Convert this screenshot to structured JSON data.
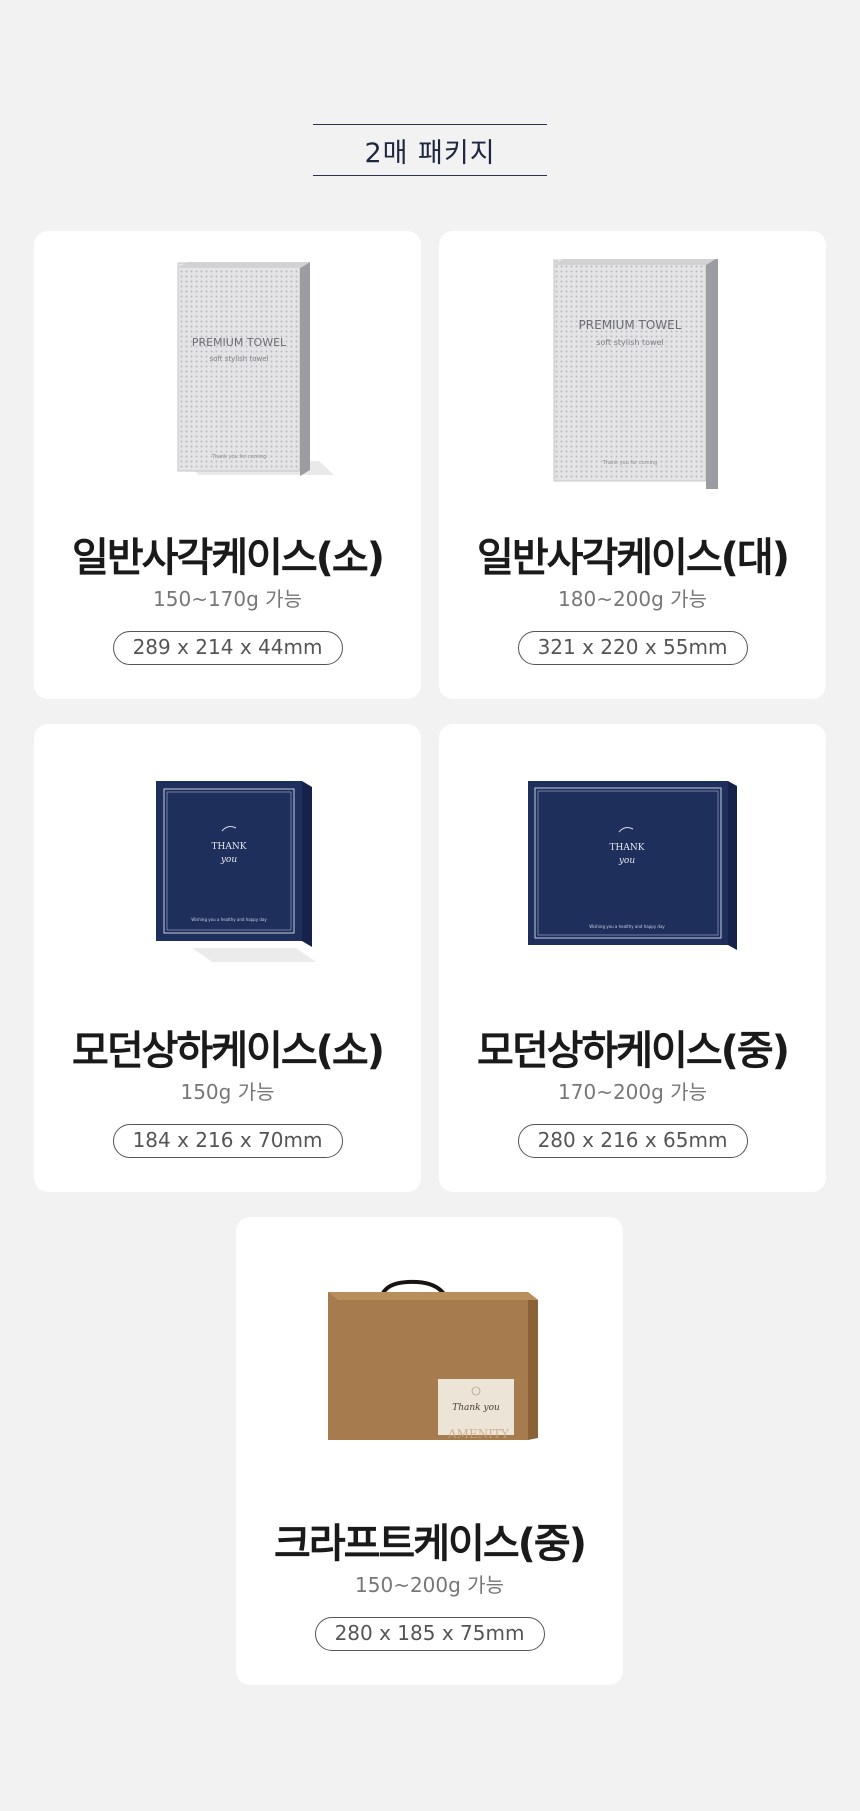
{
  "header": {
    "title": "2매 패키지"
  },
  "products": [
    {
      "name": "일반사각케이스(소)",
      "capacity": "150~170g 가능",
      "dimensions": "289 x 214 x 44mm",
      "box": {
        "brand": "PREMIUM TOWEL",
        "subtitle": "soft stylish towel",
        "footer": "Thank you for coming"
      }
    },
    {
      "name": "일반사각케이스(대)",
      "capacity": "180~200g 가능",
      "dimensions": "321 x 220 x 55mm",
      "box": {
        "brand": "PREMIUM TOWEL",
        "subtitle": "soft stylish towel",
        "footer": "Thank you for coming"
      }
    },
    {
      "name": "모던상하케이스(소)",
      "capacity": "150g 가능",
      "dimensions": "184 x 216 x 70mm",
      "box": {
        "line1": "THANK",
        "line2": "you",
        "footer": "Wishing you a healthy and happy day"
      }
    },
    {
      "name": "모던상하케이스(중)",
      "capacity": "170~200g 가능",
      "dimensions": "280 x 216 x 65mm",
      "box": {
        "line1": "THANK",
        "line2": "you",
        "footer": "Wishing you a healthy and happy day"
      }
    },
    {
      "name": "크라프트케이스(중)",
      "capacity": "150~200g 가능",
      "dimensions": "280 x 185 x 75mm",
      "box": {
        "label": "Thank you",
        "watermark": "AMENITY"
      }
    }
  ],
  "colors": {
    "background": "#f2f2f2",
    "card": "#ffffff",
    "navy": "#1f2f5c",
    "kraft": "#a67c4e",
    "text": "#1a1a1a"
  }
}
